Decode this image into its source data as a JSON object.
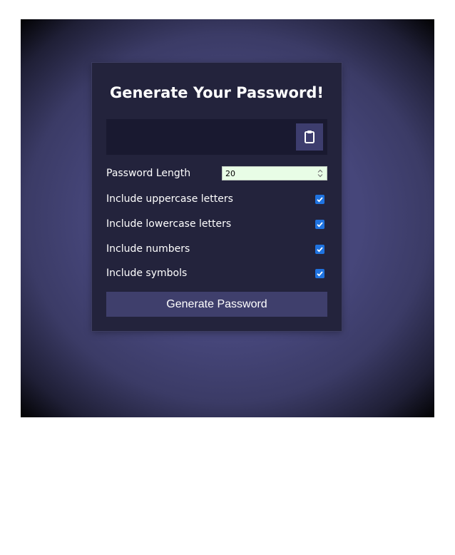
{
  "card": {
    "title": "Generate Your Password!"
  },
  "result": {
    "value": ""
  },
  "clipboard_button": {
    "icon": "clipboard-icon"
  },
  "settings": {
    "length_label": "Password Length",
    "length_value": "20",
    "options": [
      {
        "label": "Include uppercase letters",
        "checked": true
      },
      {
        "label": "Include lowercase letters",
        "checked": true
      },
      {
        "label": "Include numbers",
        "checked": true
      },
      {
        "label": "Include symbols",
        "checked": true
      }
    ]
  },
  "generate_button": {
    "label": "Generate Password"
  },
  "colors": {
    "page_background": "#46467a",
    "card_background": "#23233c",
    "result_background": "#191930",
    "button_background": "#3f3f6c",
    "checkbox_accent": "#1f73e0",
    "length_input_background": "#e8fde6"
  }
}
